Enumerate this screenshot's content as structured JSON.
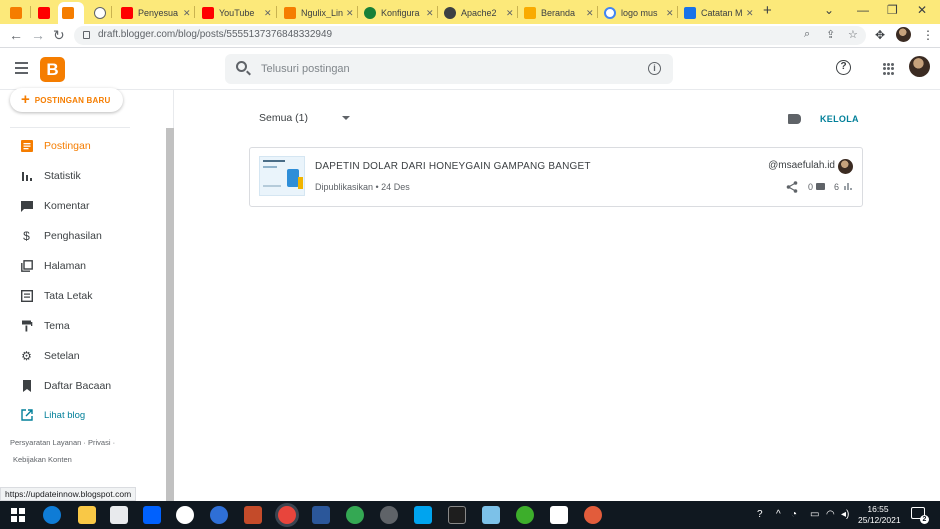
{
  "browser": {
    "tabs": [
      {
        "label": "",
        "favicon_color": "#f57d00"
      },
      {
        "label": "",
        "favicon_color": "#ff0000"
      },
      {
        "label": "",
        "favicon_color": "#f57d00"
      },
      {
        "label": "",
        "favicon_color": "#5f6368"
      },
      {
        "label": "Penyesua",
        "favicon_color": "#ff0000"
      },
      {
        "label": "YouTube",
        "favicon_color": "#ff0000"
      },
      {
        "label": "Ngulix_Lin",
        "favicon_color": "#f57d00"
      },
      {
        "label": "Konfigura",
        "favicon_color": "#188038"
      },
      {
        "label": "Apache2",
        "favicon_color": "#3c4043"
      },
      {
        "label": "Beranda",
        "favicon_color": "#f9ab00"
      },
      {
        "label": "logo mus",
        "favicon_color": "#4285f4"
      },
      {
        "label": "Catatan M",
        "favicon_color": "#1a73e8"
      }
    ],
    "url": "draft.blogger.com/blog/posts/5555137376848332949"
  },
  "header": {
    "search_placeholder": "Telusuri postingan"
  },
  "sidebar": {
    "new_post_label": "POSTINGAN BARU",
    "items": [
      {
        "label": "Postingan",
        "icon": "posts-icon"
      },
      {
        "label": "Statistik",
        "icon": "stats-icon"
      },
      {
        "label": "Komentar",
        "icon": "comments-icon"
      },
      {
        "label": "Penghasilan",
        "icon": "earnings-icon"
      },
      {
        "label": "Halaman",
        "icon": "pages-icon"
      },
      {
        "label": "Tata Letak",
        "icon": "layout-icon"
      },
      {
        "label": "Tema",
        "icon": "theme-icon"
      },
      {
        "label": "Setelan",
        "icon": "settings-icon"
      },
      {
        "label": "Daftar Bacaan",
        "icon": "reading-list-icon"
      },
      {
        "label": "Lihat blog",
        "icon": "view-blog-icon"
      }
    ],
    "footer": {
      "terms": "Persyaratan Layanan",
      "privacy": "Privasi",
      "content_policy": "Kebijakan Konten"
    }
  },
  "main": {
    "filter_label": "Semua (1)",
    "manage_label": "KELOLA",
    "posts": [
      {
        "title": "DAPETIN DOLAR DARI HONEYGAIN GAMPANG BANGET",
        "status": "Dipublikasikan • 24 Des",
        "author": "@msaefulah.id",
        "comments": "0",
        "views": "6"
      }
    ]
  },
  "status_bar": {
    "link": "https://updateinnow.blogspot.com"
  },
  "taskbar": {
    "time": "16:55",
    "date": "25/12/2021",
    "notification_count": "2"
  },
  "colors": {
    "blogger_orange": "#f57d00",
    "accent_teal": "#03809a",
    "tab_strip": "#fce97a",
    "taskbar": "#101820"
  }
}
